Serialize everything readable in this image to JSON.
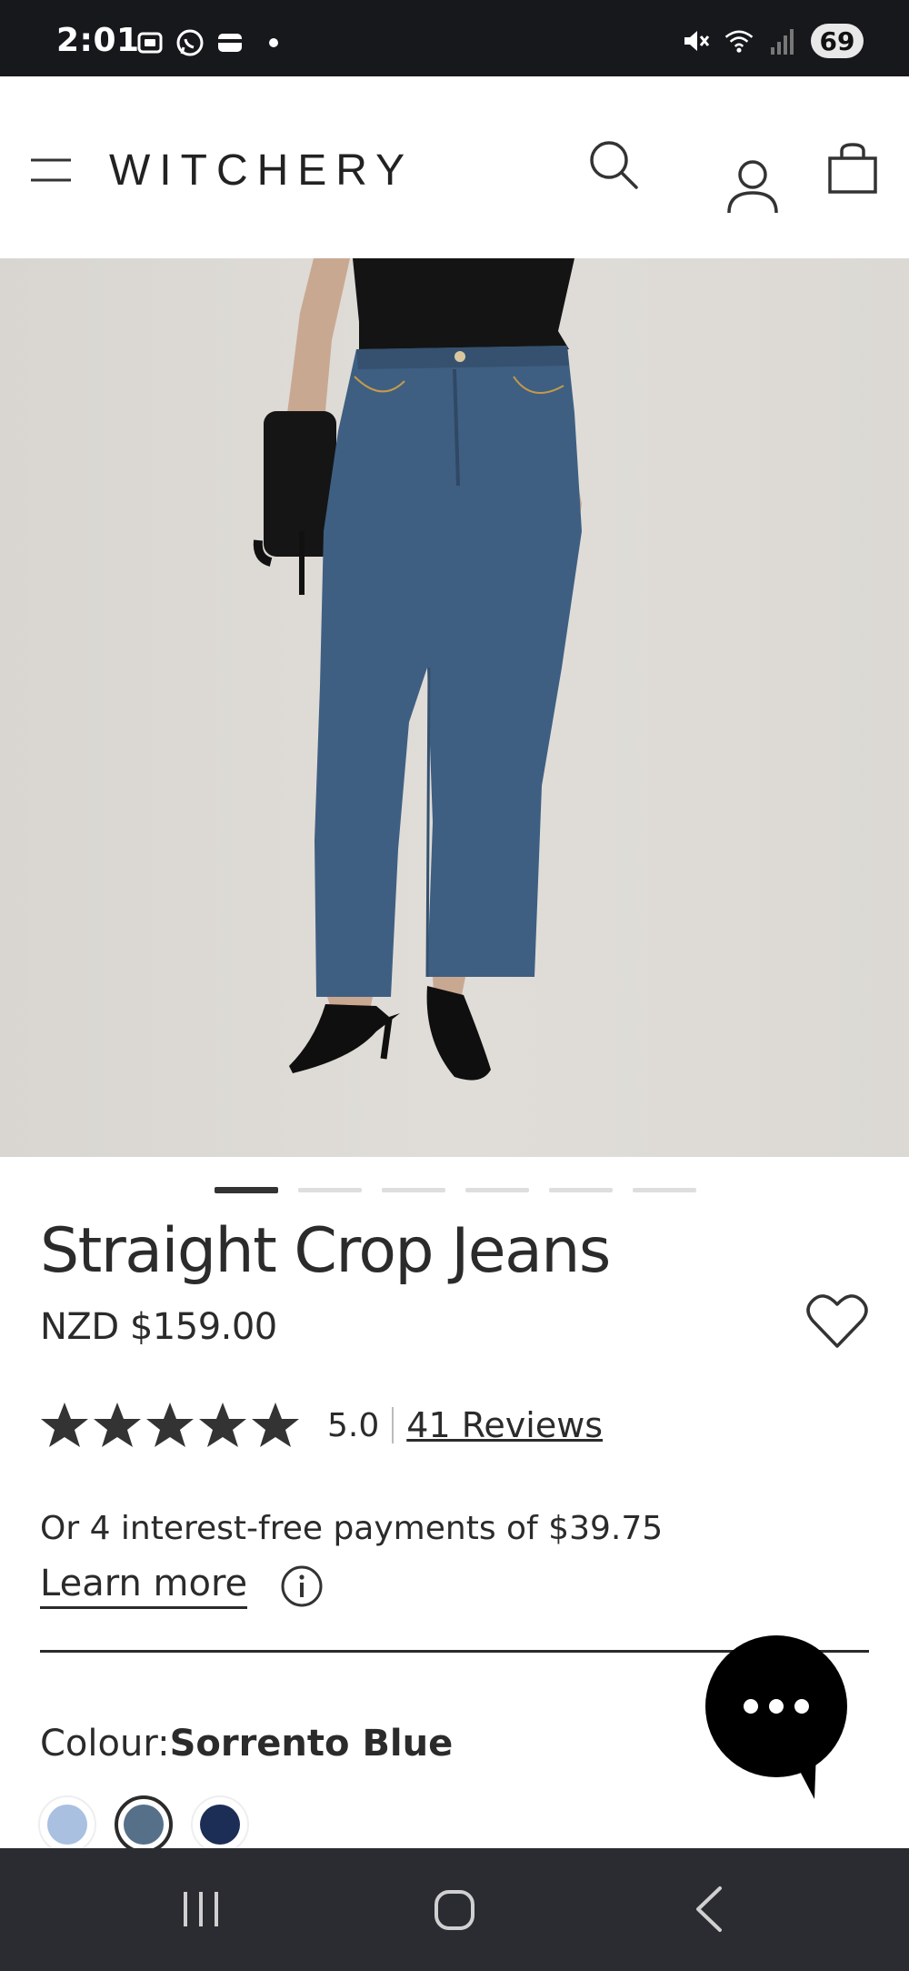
{
  "status_bar": {
    "time": "2:01",
    "battery": "69"
  },
  "header": {
    "brand": "WITCHERY"
  },
  "product": {
    "title": "Straight Crop Jeans",
    "price": "NZD $159.00",
    "rating_value": "5.0",
    "reviews_label": "41 Reviews",
    "stars": 5,
    "payments_text": "Or 4 interest-free payments of $39.75",
    "learn_more_label": "Learn more",
    "colour_label": "Colour:",
    "colour_value": "Sorrento Blue",
    "swatches": [
      {
        "name": "light-blue",
        "color": "#a9c0e0",
        "selected": false
      },
      {
        "name": "sorrento-blue",
        "color": "#56708a",
        "selected": true
      },
      {
        "name": "dark-navy",
        "color": "#1c2d56",
        "selected": false
      }
    ]
  },
  "carousel": {
    "total": 6,
    "active_index": 0
  },
  "colors": {
    "status_bar_bg": "#17181c",
    "nav_bar_bg": "#2b2c31",
    "text": "#2b2b2b"
  }
}
